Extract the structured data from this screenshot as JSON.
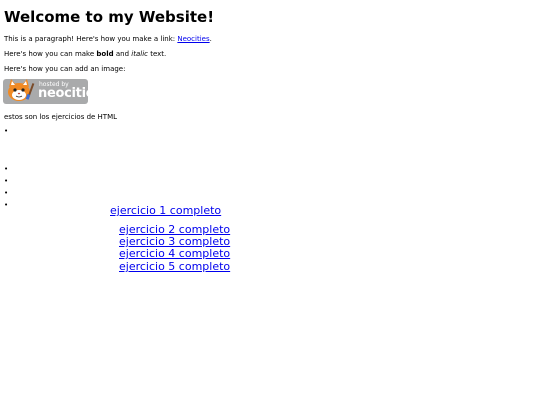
{
  "page": {
    "title": "Welcome to my Website!",
    "para_link": {
      "before": "This is a paragraph! Here's how you make a link: ",
      "link": "Neocities",
      "after": "."
    },
    "para_bold": {
      "before": "Here's how you can make ",
      "bold": "bold",
      "middle": " and ",
      "italic": "italic",
      "after": " text."
    },
    "para_image": "Here's how you can add an image:",
    "badge": {
      "hosted": "hosted by",
      "name": "neocities"
    },
    "subtitle": "estos son los ejercicios de HTML",
    "bullet": "•",
    "exercises": [
      "ejercicio 1 completo",
      "ejercicio 2 completo",
      "ejercicio 3 completo",
      "ejercicio 4 completo",
      "ejercicio 5 completo"
    ]
  },
  "colors": {
    "link": "#0000ee",
    "badge_bg": "#a9aaab",
    "badge_cat": "#f08a24"
  }
}
